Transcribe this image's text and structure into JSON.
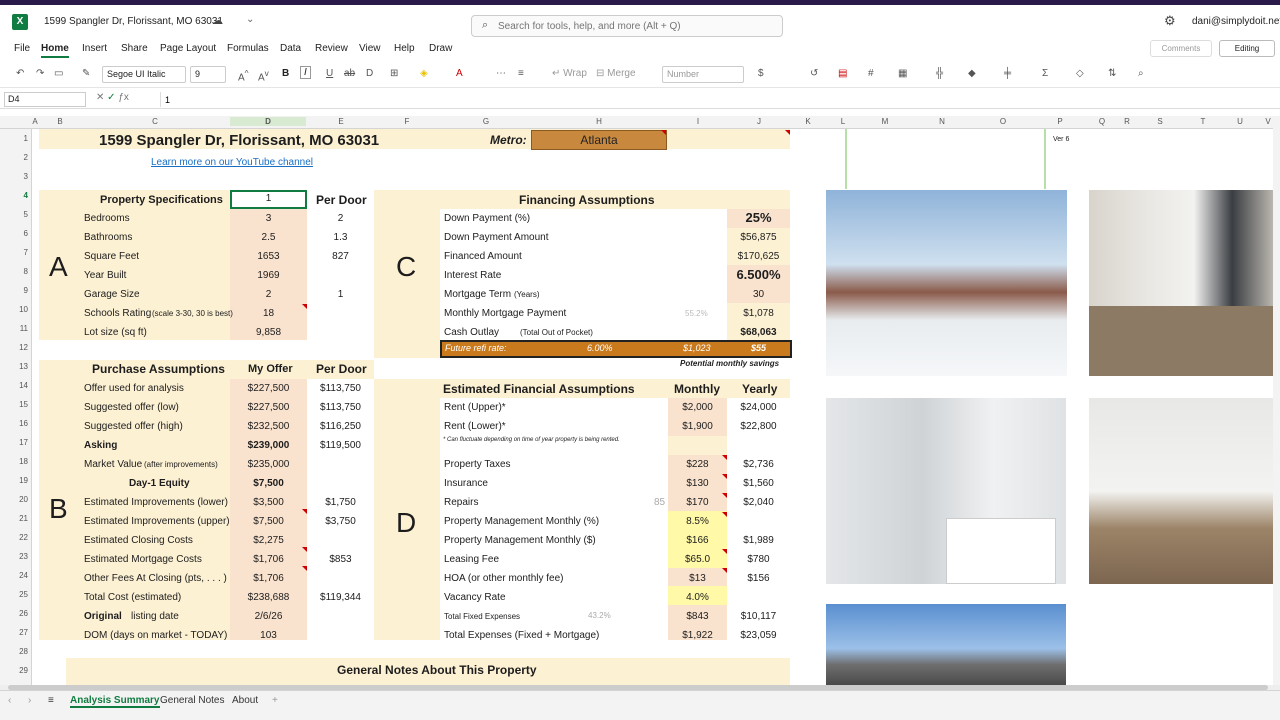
{
  "app": {
    "title": "1599 Spangler Dr, Florissant, MO 63031",
    "search_placeholder": "Search for tools, help, and more (Alt + Q)",
    "user": "dani@simplydoit.net"
  },
  "menu": [
    "File",
    "Home",
    "Insert",
    "Share",
    "Page Layout",
    "Formulas",
    "Data",
    "Review",
    "View",
    "Help",
    "Draw"
  ],
  "buttons": {
    "comments": "Comments",
    "editing": "Editing"
  },
  "toolbar": {
    "font": "Segoe UI Italic",
    "size": "9",
    "wrap": "Wrap",
    "merge": "Merge",
    "number": "Number"
  },
  "formula": {
    "cell": "D4",
    "value": "1"
  },
  "columns": [
    "A",
    "B",
    "C",
    "D",
    "E",
    "F",
    "G",
    "H",
    "I",
    "J",
    "K",
    "L",
    "M",
    "N",
    "O",
    "P",
    "Q",
    "R",
    "S",
    "T",
    "U",
    "V"
  ],
  "rows": [
    "1",
    "2",
    "3",
    "4",
    "5",
    "6",
    "7",
    "8",
    "9",
    "10",
    "11",
    "12",
    "13",
    "14",
    "15",
    "16",
    "17",
    "18",
    "19",
    "20",
    "21",
    "22",
    "23",
    "24",
    "25",
    "26",
    "27",
    "28",
    "29"
  ],
  "header": {
    "address": "1599 Spangler Dr, Florissant, MO 63031",
    "youtube": "Learn more on our YouTube channel",
    "metro_label": "Metro:",
    "metro": "Atlanta",
    "version": "Ver 6"
  },
  "sections": {
    "A": "A",
    "B": "B",
    "C": "C",
    "D": "D"
  },
  "property": {
    "title": "Property Specifications",
    "per_door": "Per Door",
    "input": "1",
    "rows": [
      {
        "label": "Bedrooms",
        "value": "3",
        "door": "2"
      },
      {
        "label": "Bathrooms",
        "value": "2.5",
        "door": "1.3"
      },
      {
        "label": "Square Feet",
        "value": "1653",
        "door": "827"
      },
      {
        "label": "Year Built",
        "value": "1969",
        "door": ""
      },
      {
        "label": "Garage Size",
        "value": "2",
        "door": "1"
      },
      {
        "label": "Schools Rating",
        "note": "(scale 3-30, 30 is best)",
        "value": "18",
        "door": ""
      },
      {
        "label": "Lot size (sq ft)",
        "value": "9,858",
        "door": ""
      }
    ]
  },
  "purchase": {
    "title": "Purchase Assumptions",
    "col1": "My Offer",
    "col2": "Per Door",
    "rows": [
      {
        "label": "Offer used for analysis",
        "value": "$227,500",
        "door": "$113,750"
      },
      {
        "label": "Suggested offer (low)",
        "value": "$227,500",
        "door": "$113,750"
      },
      {
        "label": "Suggested offer (high)",
        "value": "$232,500",
        "door": "$116,250"
      },
      {
        "label": "Asking",
        "value": "$239,000",
        "door": "$119,500"
      },
      {
        "label": "Market Value",
        "note": "(after improvements)",
        "value": "$235,000",
        "door": ""
      },
      {
        "label": "Day-1 Equity",
        "value": "$7,500",
        "door": ""
      },
      {
        "label": "Estimated Improvements (lower)",
        "value": "$3,500",
        "door": "$1,750"
      },
      {
        "label": "Estimated Improvements (upper)",
        "value": "$7,500",
        "door": "$3,750"
      },
      {
        "label": "Estimated Closing Costs",
        "value": "$2,275",
        "door": ""
      },
      {
        "label": "Estimated Mortgage Costs",
        "value": "$1,706",
        "door": "$853"
      },
      {
        "label": "Other Fees At Closing (pts, . . . )",
        "value": "$1,706",
        "door": ""
      },
      {
        "label": "Total Cost (estimated)",
        "value": "$238,688",
        "door": "$119,344"
      },
      {
        "label_bold": "Original",
        "label": " listing date",
        "value": "2/6/26",
        "door": ""
      },
      {
        "label": "DOM (days on market - TODAY)",
        "value": "103",
        "door": ""
      }
    ]
  },
  "financing": {
    "title": "Financing Assumptions",
    "rows": [
      {
        "label": "Down Payment (%)",
        "value": "25%"
      },
      {
        "label": "Down Payment Amount",
        "value": "$56,875"
      },
      {
        "label": "Financed Amount",
        "value": "$170,625"
      },
      {
        "label": "Interest Rate",
        "value": "6.500%"
      },
      {
        "label": "Mortgage Term",
        "note": "(Years)",
        "value": "30"
      },
      {
        "label": "Monthly Mortgage Payment",
        "faint": "55.2%",
        "value": "$1,078"
      },
      {
        "label": "Cash Outlay",
        "note": "(Total Out of Pocket)",
        "value": "$68,063"
      }
    ],
    "refi": {
      "label": "Future refi rate:",
      "rate": "6.00%",
      "payment": "$1,023",
      "savings": "$55"
    },
    "savings_note": "Potential monthly savings"
  },
  "estimated": {
    "title": "Estimated Financial Assumptions",
    "monthly": "Monthly",
    "yearly": "Yearly",
    "rent": [
      {
        "label": "Rent (Upper)*",
        "monthly": "$2,000",
        "yearly": "$24,000"
      },
      {
        "label": "Rent (Lower)*",
        "monthly": "$1,900",
        "yearly": "$22,800"
      }
    ],
    "rent_note": "* Can fluctuate depending on time of year property is being rented.",
    "expenses": [
      {
        "label": "Property Taxes",
        "monthly": "$228",
        "yearly": "$2,736"
      },
      {
        "label": "Insurance",
        "monthly": "$130",
        "yearly": "$1,560"
      },
      {
        "label": "Repairs",
        "faint": "85",
        "monthly": "$170",
        "yearly": "$2,040"
      },
      {
        "label": "Property Management Monthly (%)",
        "monthly": "8.5%",
        "yearly": ""
      },
      {
        "label": "Property Management Monthly ($)",
        "monthly": "$166",
        "yearly": "$1,989"
      },
      {
        "label": "Leasing Fee",
        "monthly": "$65.0",
        "yearly": "$780"
      },
      {
        "label": "HOA (or other monthly fee)",
        "monthly": "$13",
        "yearly": "$156"
      },
      {
        "label": "Vacancy Rate",
        "monthly": "4.0%",
        "yearly": ""
      },
      {
        "label": "Total Fixed Expenses",
        "faint": "43.2%",
        "monthly": "$843",
        "yearly": "$10,117"
      },
      {
        "label": "Total Expenses (Fixed + Mortgage)",
        "monthly": "$1,922",
        "yearly": "$23,059"
      }
    ]
  },
  "notes": {
    "title": "General Notes About This Property"
  },
  "tabs": [
    "Analysis Summary",
    "General Notes",
    "About"
  ]
}
